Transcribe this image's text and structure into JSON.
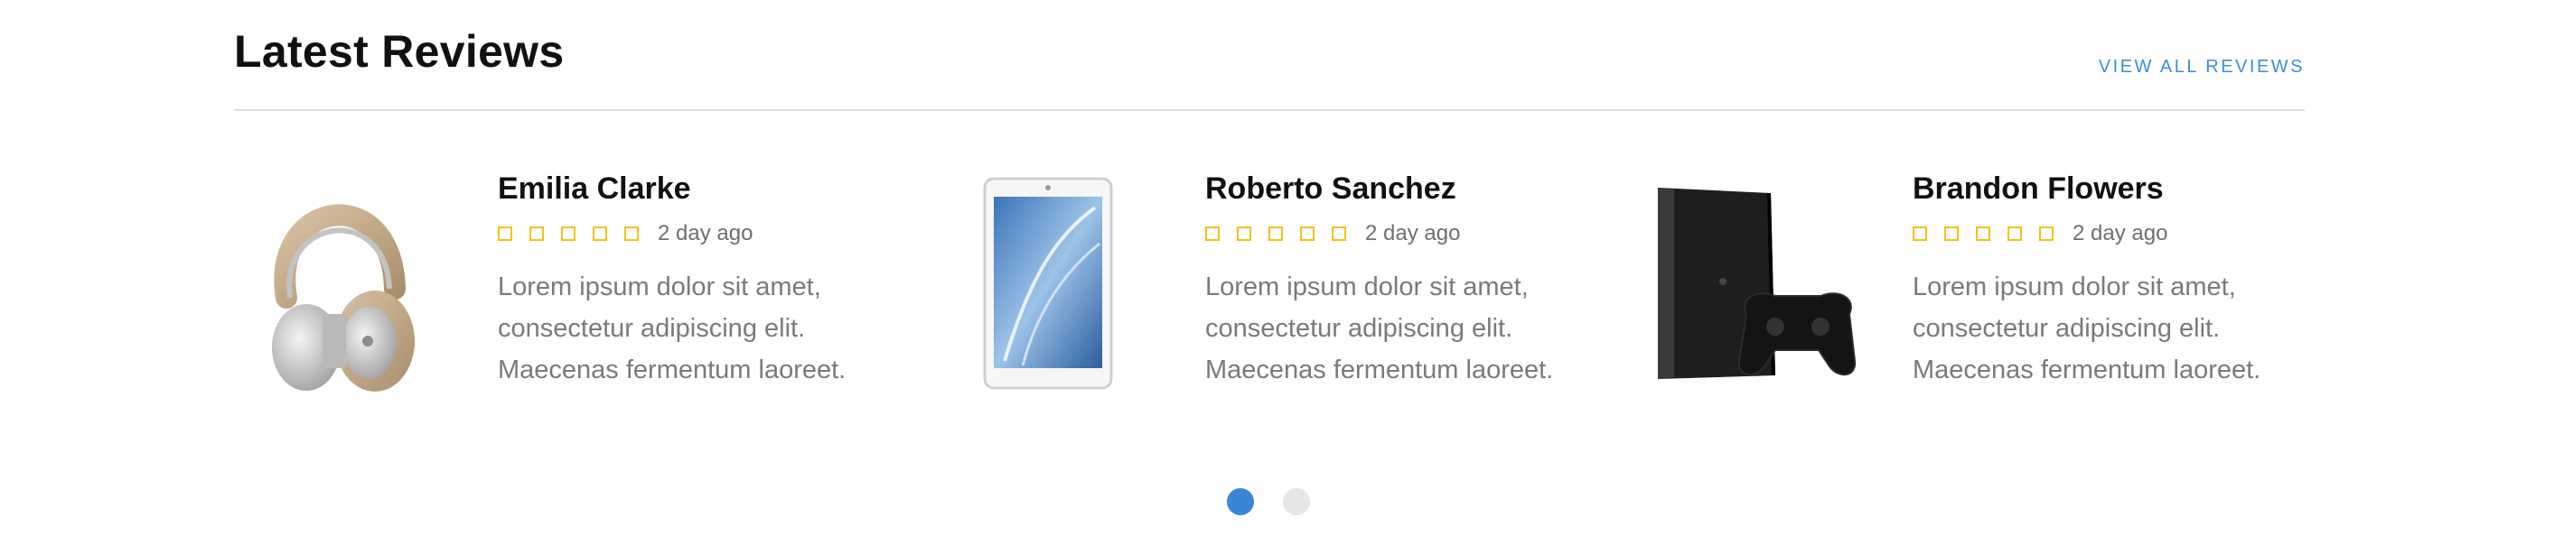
{
  "section": {
    "title": "Latest Reviews",
    "view_all": "VIEW ALL REVIEWS"
  },
  "reviews": [
    {
      "name": "Emilia Clarke",
      "product_icon": "headphones-image",
      "rating": 0,
      "max_rating": 5,
      "date": "2 day ago",
      "lines": [
        "Lorem ipsum dolor sit amet,",
        "consectetur adipiscing elit.",
        "Maecenas fermentum laoreet."
      ]
    },
    {
      "name": "Roberto Sanchez",
      "product_icon": "tablet-image",
      "rating": 0,
      "max_rating": 5,
      "date": "2 day ago",
      "lines": [
        "Lorem ipsum dolor sit amet,",
        "consectetur adipiscing elit.",
        "Maecenas fermentum laoreet."
      ]
    },
    {
      "name": "Brandon Flowers",
      "product_icon": "game-console-image",
      "rating": 0,
      "max_rating": 5,
      "date": "2 day ago",
      "lines": [
        "Lorem ipsum dolor sit amet,",
        "consectetur adipiscing elit.",
        "Maecenas fermentum laoreet."
      ]
    }
  ],
  "carousel": {
    "pages": 2,
    "active_page": 1
  },
  "colors": {
    "accent": "#3d8ddc",
    "star": "#f3c316",
    "dot_active": "#3a86d8",
    "dot_inactive": "#e6e6e6"
  }
}
